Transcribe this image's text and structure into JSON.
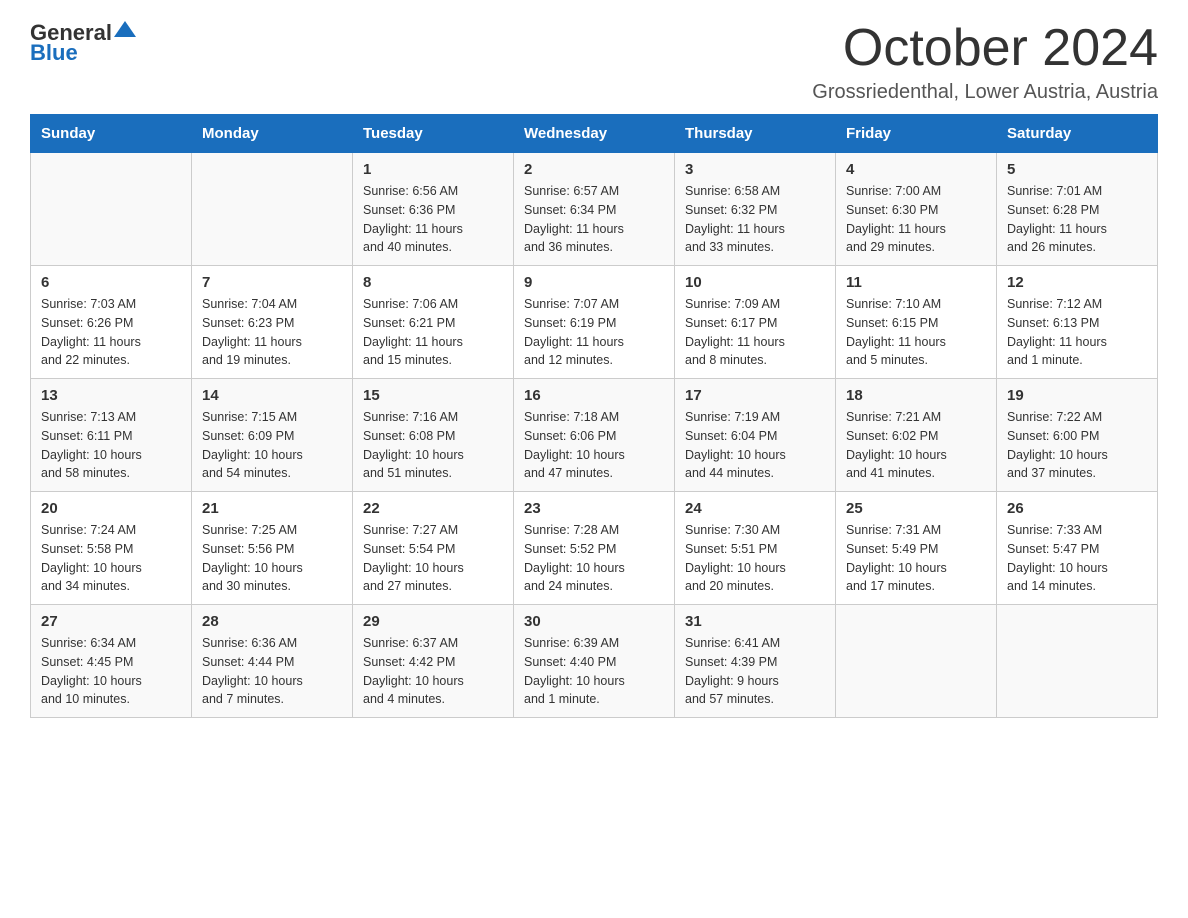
{
  "header": {
    "logo_general": "General",
    "logo_blue": "Blue",
    "month_year": "October 2024",
    "location": "Grossriedenthal, Lower Austria, Austria"
  },
  "weekdays": [
    "Sunday",
    "Monday",
    "Tuesday",
    "Wednesday",
    "Thursday",
    "Friday",
    "Saturday"
  ],
  "weeks": [
    [
      {
        "day": "",
        "info": ""
      },
      {
        "day": "",
        "info": ""
      },
      {
        "day": "1",
        "info": "Sunrise: 6:56 AM\nSunset: 6:36 PM\nDaylight: 11 hours\nand 40 minutes."
      },
      {
        "day": "2",
        "info": "Sunrise: 6:57 AM\nSunset: 6:34 PM\nDaylight: 11 hours\nand 36 minutes."
      },
      {
        "day": "3",
        "info": "Sunrise: 6:58 AM\nSunset: 6:32 PM\nDaylight: 11 hours\nand 33 minutes."
      },
      {
        "day": "4",
        "info": "Sunrise: 7:00 AM\nSunset: 6:30 PM\nDaylight: 11 hours\nand 29 minutes."
      },
      {
        "day": "5",
        "info": "Sunrise: 7:01 AM\nSunset: 6:28 PM\nDaylight: 11 hours\nand 26 minutes."
      }
    ],
    [
      {
        "day": "6",
        "info": "Sunrise: 7:03 AM\nSunset: 6:26 PM\nDaylight: 11 hours\nand 22 minutes."
      },
      {
        "day": "7",
        "info": "Sunrise: 7:04 AM\nSunset: 6:23 PM\nDaylight: 11 hours\nand 19 minutes."
      },
      {
        "day": "8",
        "info": "Sunrise: 7:06 AM\nSunset: 6:21 PM\nDaylight: 11 hours\nand 15 minutes."
      },
      {
        "day": "9",
        "info": "Sunrise: 7:07 AM\nSunset: 6:19 PM\nDaylight: 11 hours\nand 12 minutes."
      },
      {
        "day": "10",
        "info": "Sunrise: 7:09 AM\nSunset: 6:17 PM\nDaylight: 11 hours\nand 8 minutes."
      },
      {
        "day": "11",
        "info": "Sunrise: 7:10 AM\nSunset: 6:15 PM\nDaylight: 11 hours\nand 5 minutes."
      },
      {
        "day": "12",
        "info": "Sunrise: 7:12 AM\nSunset: 6:13 PM\nDaylight: 11 hours\nand 1 minute."
      }
    ],
    [
      {
        "day": "13",
        "info": "Sunrise: 7:13 AM\nSunset: 6:11 PM\nDaylight: 10 hours\nand 58 minutes."
      },
      {
        "day": "14",
        "info": "Sunrise: 7:15 AM\nSunset: 6:09 PM\nDaylight: 10 hours\nand 54 minutes."
      },
      {
        "day": "15",
        "info": "Sunrise: 7:16 AM\nSunset: 6:08 PM\nDaylight: 10 hours\nand 51 minutes."
      },
      {
        "day": "16",
        "info": "Sunrise: 7:18 AM\nSunset: 6:06 PM\nDaylight: 10 hours\nand 47 minutes."
      },
      {
        "day": "17",
        "info": "Sunrise: 7:19 AM\nSunset: 6:04 PM\nDaylight: 10 hours\nand 44 minutes."
      },
      {
        "day": "18",
        "info": "Sunrise: 7:21 AM\nSunset: 6:02 PM\nDaylight: 10 hours\nand 41 minutes."
      },
      {
        "day": "19",
        "info": "Sunrise: 7:22 AM\nSunset: 6:00 PM\nDaylight: 10 hours\nand 37 minutes."
      }
    ],
    [
      {
        "day": "20",
        "info": "Sunrise: 7:24 AM\nSunset: 5:58 PM\nDaylight: 10 hours\nand 34 minutes."
      },
      {
        "day": "21",
        "info": "Sunrise: 7:25 AM\nSunset: 5:56 PM\nDaylight: 10 hours\nand 30 minutes."
      },
      {
        "day": "22",
        "info": "Sunrise: 7:27 AM\nSunset: 5:54 PM\nDaylight: 10 hours\nand 27 minutes."
      },
      {
        "day": "23",
        "info": "Sunrise: 7:28 AM\nSunset: 5:52 PM\nDaylight: 10 hours\nand 24 minutes."
      },
      {
        "day": "24",
        "info": "Sunrise: 7:30 AM\nSunset: 5:51 PM\nDaylight: 10 hours\nand 20 minutes."
      },
      {
        "day": "25",
        "info": "Sunrise: 7:31 AM\nSunset: 5:49 PM\nDaylight: 10 hours\nand 17 minutes."
      },
      {
        "day": "26",
        "info": "Sunrise: 7:33 AM\nSunset: 5:47 PM\nDaylight: 10 hours\nand 14 minutes."
      }
    ],
    [
      {
        "day": "27",
        "info": "Sunrise: 6:34 AM\nSunset: 4:45 PM\nDaylight: 10 hours\nand 10 minutes."
      },
      {
        "day": "28",
        "info": "Sunrise: 6:36 AM\nSunset: 4:44 PM\nDaylight: 10 hours\nand 7 minutes."
      },
      {
        "day": "29",
        "info": "Sunrise: 6:37 AM\nSunset: 4:42 PM\nDaylight: 10 hours\nand 4 minutes."
      },
      {
        "day": "30",
        "info": "Sunrise: 6:39 AM\nSunset: 4:40 PM\nDaylight: 10 hours\nand 1 minute."
      },
      {
        "day": "31",
        "info": "Sunrise: 6:41 AM\nSunset: 4:39 PM\nDaylight: 9 hours\nand 57 minutes."
      },
      {
        "day": "",
        "info": ""
      },
      {
        "day": "",
        "info": ""
      }
    ]
  ]
}
